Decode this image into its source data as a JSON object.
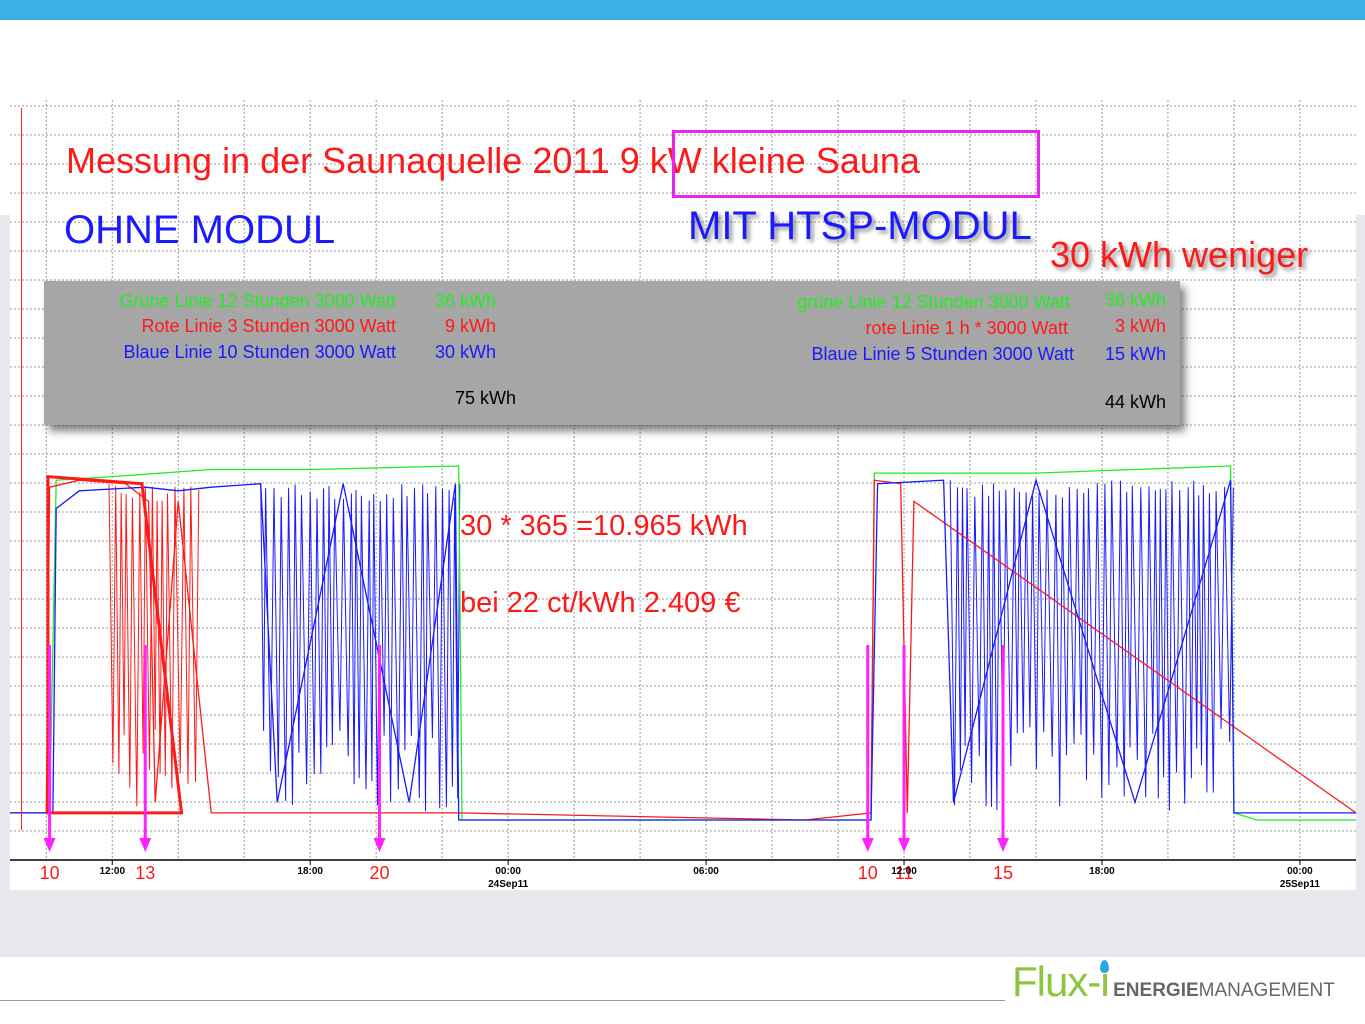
{
  "slide": {
    "title": "Messung in der Saunaquelle 2011 9 kW kleine Sauna",
    "left_label": "OHNE MODUL",
    "right_label": "MIT HTSP-MODUL",
    "savings": "30 kWh weniger",
    "calc_line1": "30 * 365 =10.965 kWh",
    "calc_line2": "bei 22 ct/kWh 2.409 €",
    "logo_main": "Flux-i",
    "logo_energie": "ENERGIE",
    "logo_management": "MANAGEMENT"
  },
  "summary_left": [
    {
      "text": "Grüne Linie 12 Stunden 3000 Watt",
      "value": "36 kWh",
      "color": "#22ee22"
    },
    {
      "text": "Rote Linie 3 Stunden 3000 Watt",
      "value": "9 kWh",
      "color": "#ff1a1a"
    },
    {
      "text": "Blaue Linie 10 Stunden 3000 Watt",
      "value": "30 kWh",
      "color": "#1a1aff"
    }
  ],
  "summary_left_total": "75 kWh",
  "summary_right": [
    {
      "text": "grüne Linie 12 Stunden 3000 Watt",
      "value": "36 kWh",
      "color": "#22ee22"
    },
    {
      "text": "rote Linie 1 h * 3000 Watt",
      "value": "3 kWh",
      "color": "#ff1a1a"
    },
    {
      "text": "Blaue Linie 5 Stunden 3000 Watt",
      "value": "15 kWh",
      "color": "#1a1aff"
    }
  ],
  "summary_right_total": "44 kWh",
  "chart_data": {
    "type": "line",
    "x_unit": "hours since 00:00 23Sep11",
    "x_range": [
      8.9,
      49.7
    ],
    "x_ticks": [
      {
        "h": 12,
        "label": "12:00"
      },
      {
        "h": 18,
        "label": "18:00"
      },
      {
        "h": 24,
        "label": "00:00",
        "sub": "24Sep11"
      },
      {
        "h": 30,
        "label": "06:00"
      },
      {
        "h": 36,
        "label": "12:00"
      },
      {
        "h": 42,
        "label": "18:00"
      },
      {
        "h": 48,
        "label": "00:00",
        "sub": "25Sep11"
      }
    ],
    "ylim": [
      0,
      1
    ],
    "grid": true,
    "colors": {
      "green": "#22ee22",
      "red": "#ff1a1a",
      "blue": "#1a1aff",
      "marker": "#ff22ff"
    },
    "series": [
      {
        "color_key": "green",
        "x": [
          8.9,
          10.1,
          10.3,
          12.0,
          15.0,
          18.0,
          22.5,
          22.6,
          33.0,
          35.0,
          35.1,
          40.0,
          45.9,
          46.0,
          46.7,
          49.7
        ],
        "y": [
          0.02,
          0.02,
          0.96,
          0.97,
          0.99,
          0.99,
          1.0,
          0.0,
          0.0,
          0.0,
          0.98,
          0.98,
          1.0,
          0.02,
          0.0,
          0.0
        ]
      },
      {
        "color_key": "red",
        "x": [
          8.9,
          10.0,
          10.1,
          11.0,
          12.4,
          13.1,
          13.3,
          14.0,
          15.0,
          22.5,
          33.0,
          35.0,
          35.1,
          35.9,
          36.1,
          36.3,
          49.7
        ],
        "y": [
          0.02,
          0.02,
          0.94,
          0.96,
          0.95,
          0.9,
          0.05,
          0.9,
          0.02,
          0.02,
          0.0,
          0.02,
          0.96,
          0.95,
          0.02,
          0.9,
          0.02
        ]
      },
      {
        "color_key": "blue",
        "x": [
          8.9,
          10.2,
          10.3,
          11.0,
          13.0,
          14.0,
          15.0,
          16.5,
          17.0,
          19.0,
          21.0,
          22.4,
          22.5,
          33.0,
          35.0,
          35.2,
          37.2,
          37.5,
          40.0,
          43.0,
          45.9,
          46.0,
          49.7
        ],
        "y": [
          0.02,
          0.02,
          0.88,
          0.93,
          0.94,
          0.93,
          0.94,
          0.95,
          0.05,
          0.95,
          0.05,
          0.95,
          0.0,
          0.0,
          0.0,
          0.95,
          0.96,
          0.05,
          0.96,
          0.05,
          0.96,
          0.02,
          0.02
        ]
      }
    ],
    "cycling_regions": [
      {
        "color_key": "red",
        "from": 11.9,
        "to": 14.5,
        "lo": 0.02,
        "hi": 0.95
      },
      {
        "color_key": "blue",
        "from": 16.5,
        "to": 22.4,
        "lo": 0.02,
        "hi": 0.95
      },
      {
        "color_key": "blue",
        "from": 37.4,
        "to": 45.8,
        "lo": 0.02,
        "hi": 0.96
      }
    ],
    "annotations": [
      {
        "label": "10",
        "h": 10.1
      },
      {
        "label": "13",
        "h": 13.0
      },
      {
        "label": "20",
        "h": 20.1
      },
      {
        "label": "10",
        "h": 34.9
      },
      {
        "label": "11",
        "h": 36.0
      },
      {
        "label": "15",
        "h": 39.0
      }
    ]
  }
}
